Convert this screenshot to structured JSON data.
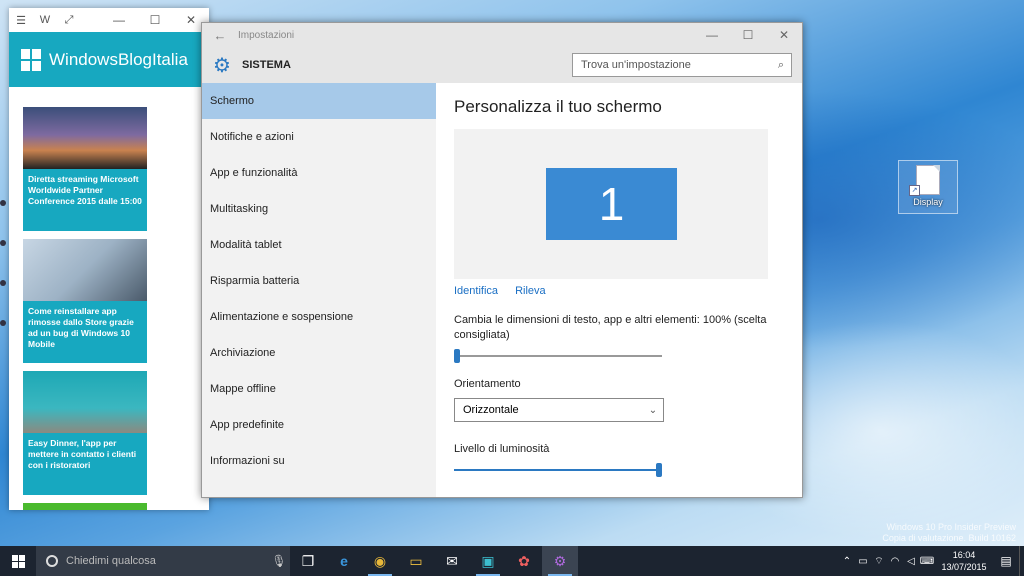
{
  "desktop": {
    "icon_label": "Display",
    "watermark": [
      "Windows 10 Pro Insider Preview",
      "Copia di valutazione. Build 10162"
    ]
  },
  "blog": {
    "title": "WindowsBlogItalia",
    "cards": [
      {
        "text": "Diretta streaming Microsoft Worldwide Partner Conference 2015 dalle 15:00"
      },
      {
        "text": "Come reinstallare app rimosse dallo Store grazie ad un bug di Windows 10 Mobile"
      },
      {
        "text": "Easy Dinner, l'app per mettere in contatto i clienti con i ristoratori"
      }
    ]
  },
  "settings": {
    "app_title": "Impostazioni",
    "section": "SISTEMA",
    "search_placeholder": "Trova un'impostazione",
    "nav": [
      "Schermo",
      "Notifiche e azioni",
      "App e funzionalità",
      "Multitasking",
      "Modalità tablet",
      "Risparmia batteria",
      "Alimentazione e sospensione",
      "Archiviazione",
      "Mappe offline",
      "App predefinite",
      "Informazioni su"
    ],
    "content": {
      "title": "Personalizza il tuo schermo",
      "monitor_number": "1",
      "link_identify": "Identifica",
      "link_detect": "Rileva",
      "scale_label": "Cambia le dimensioni di testo, app e altri elementi: 100% (scelta consigliata)",
      "scale_value": 0,
      "orientation_label": "Orientamento",
      "orientation_value": "Orizzontale",
      "brightness_label": "Livello di luminosità",
      "brightness_value": 1
    }
  },
  "taskbar": {
    "search_text": "Chiedimi qualcosa",
    "time": "16:04",
    "date": "13/07/2015"
  }
}
